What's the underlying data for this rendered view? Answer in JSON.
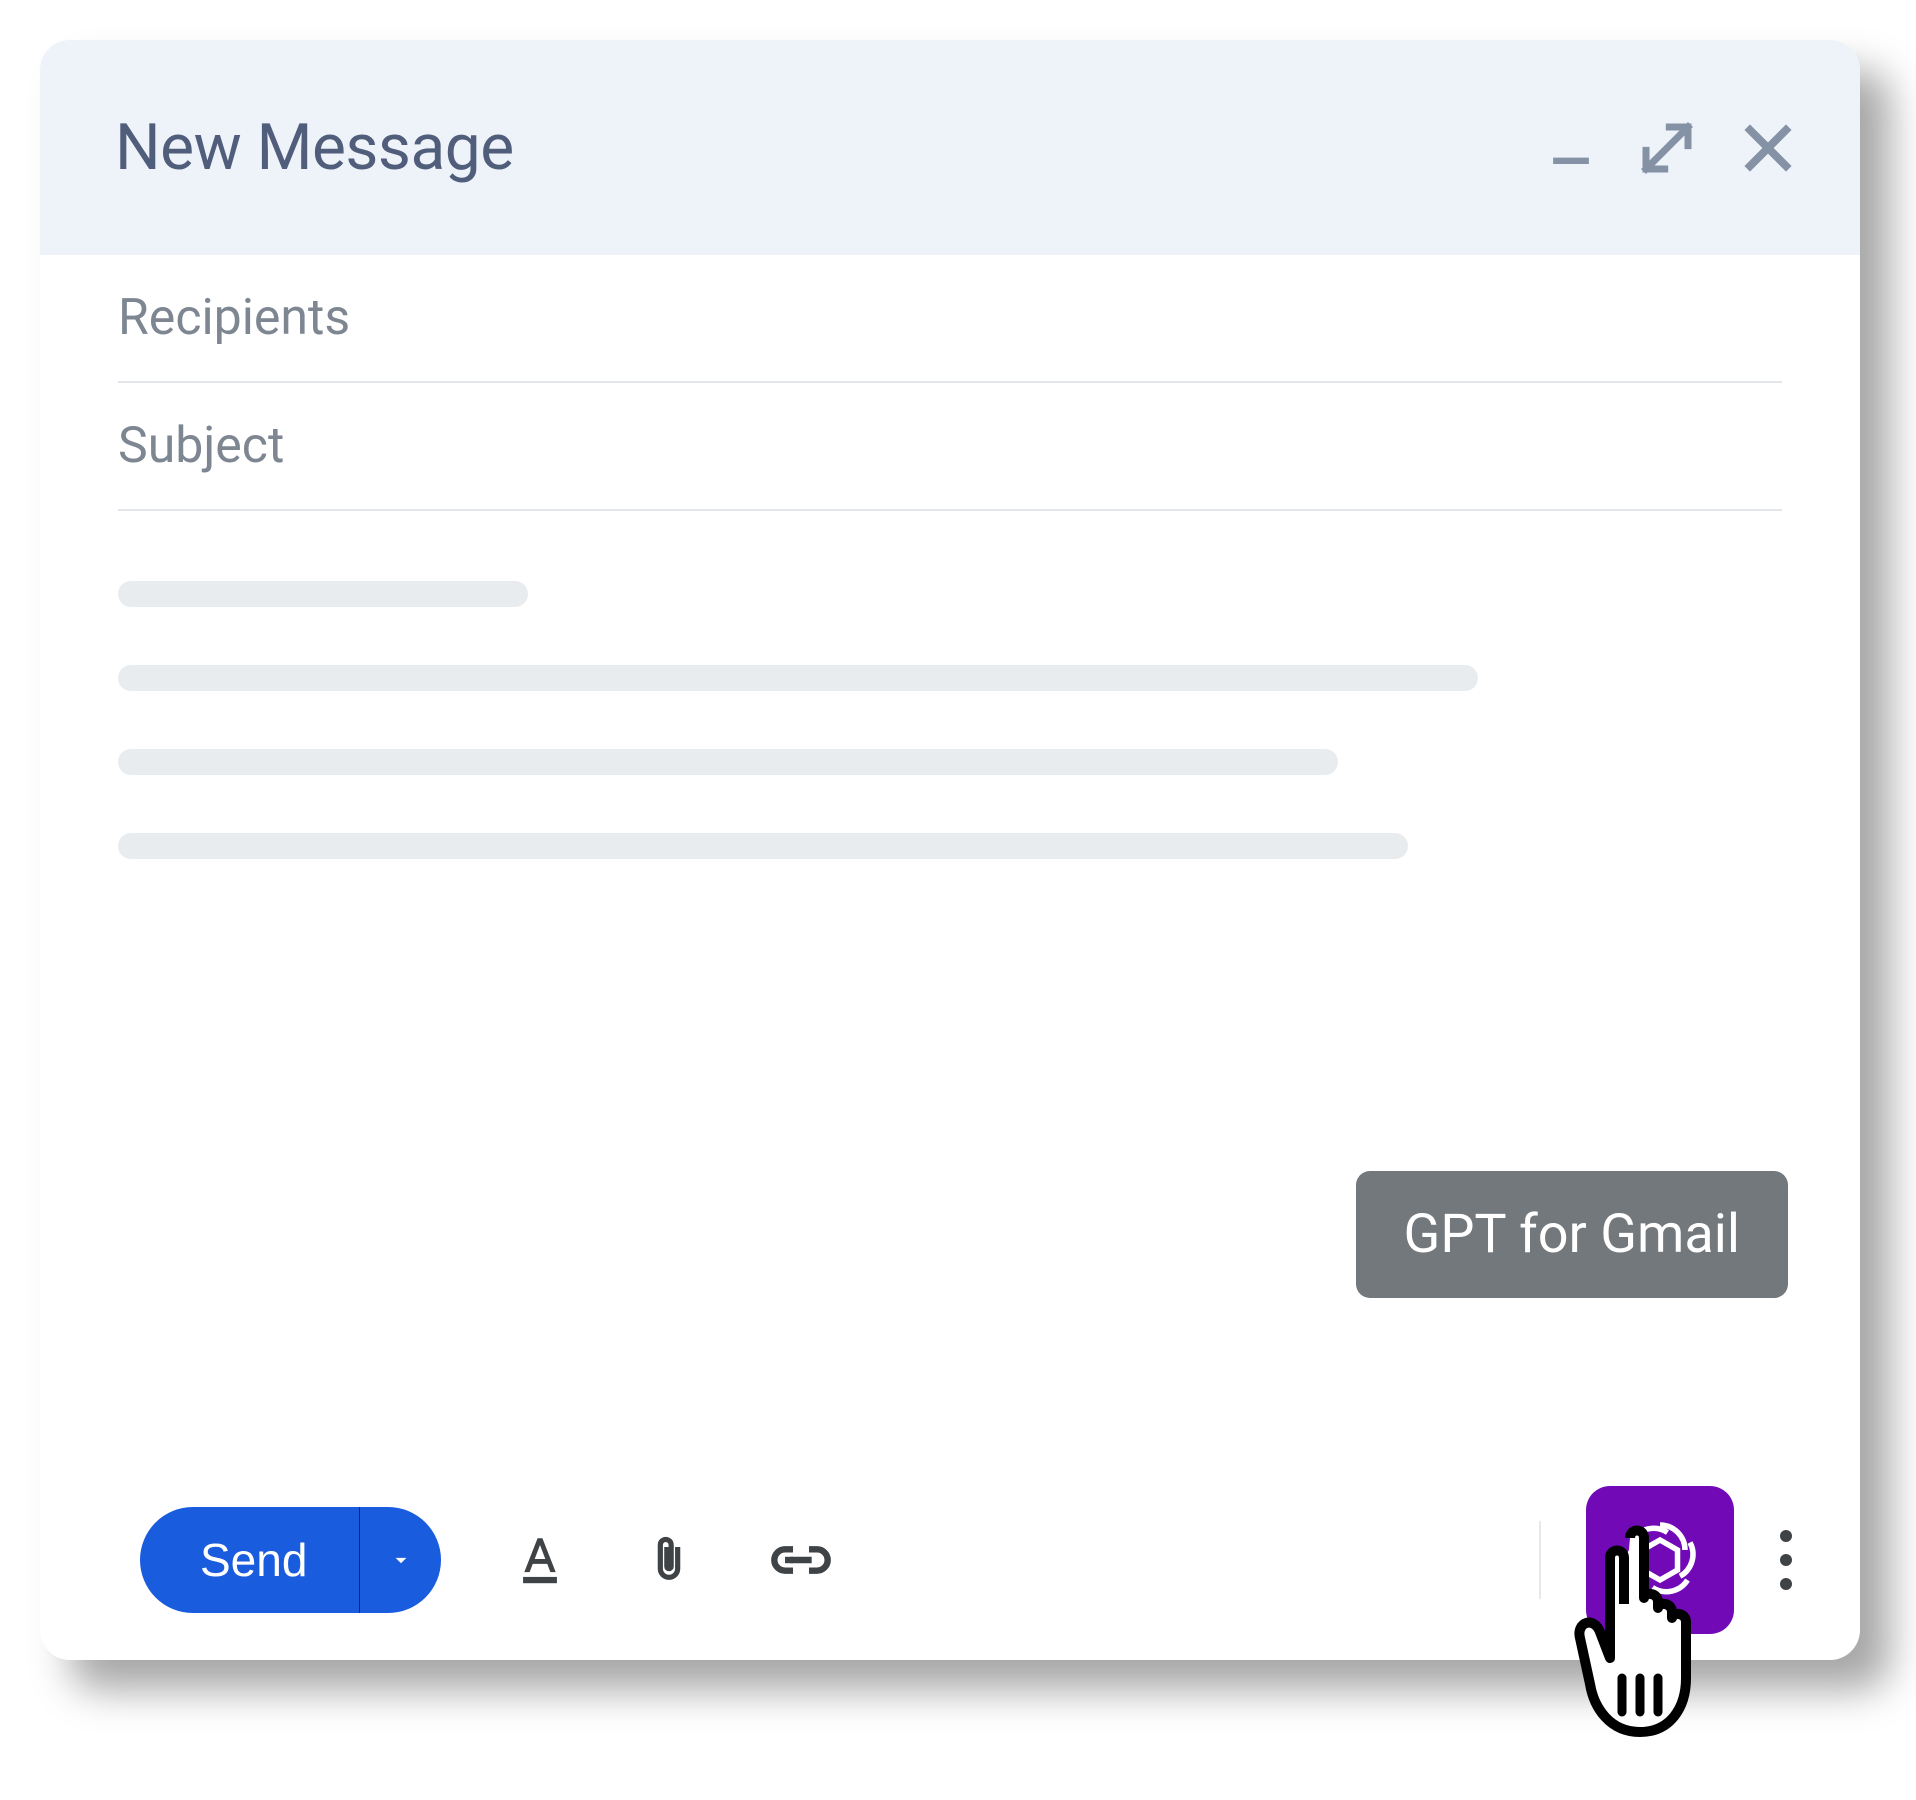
{
  "window": {
    "title": "New Message"
  },
  "fields": {
    "recipients_placeholder": "Recipients",
    "subject_placeholder": "Subject"
  },
  "toolbar": {
    "send_label": "Send",
    "icons": {
      "format": "text-format-icon",
      "attach": "paperclip-icon",
      "link": "link-icon"
    }
  },
  "extension": {
    "tooltip_label": "GPT for Gmail",
    "button_name": "gpt-for-gmail-button"
  },
  "colors": {
    "primary_blue": "#1a5cde",
    "gpt_purple": "#7209b7",
    "header_bg": "#eef3fa",
    "title_text": "#505d7b"
  }
}
